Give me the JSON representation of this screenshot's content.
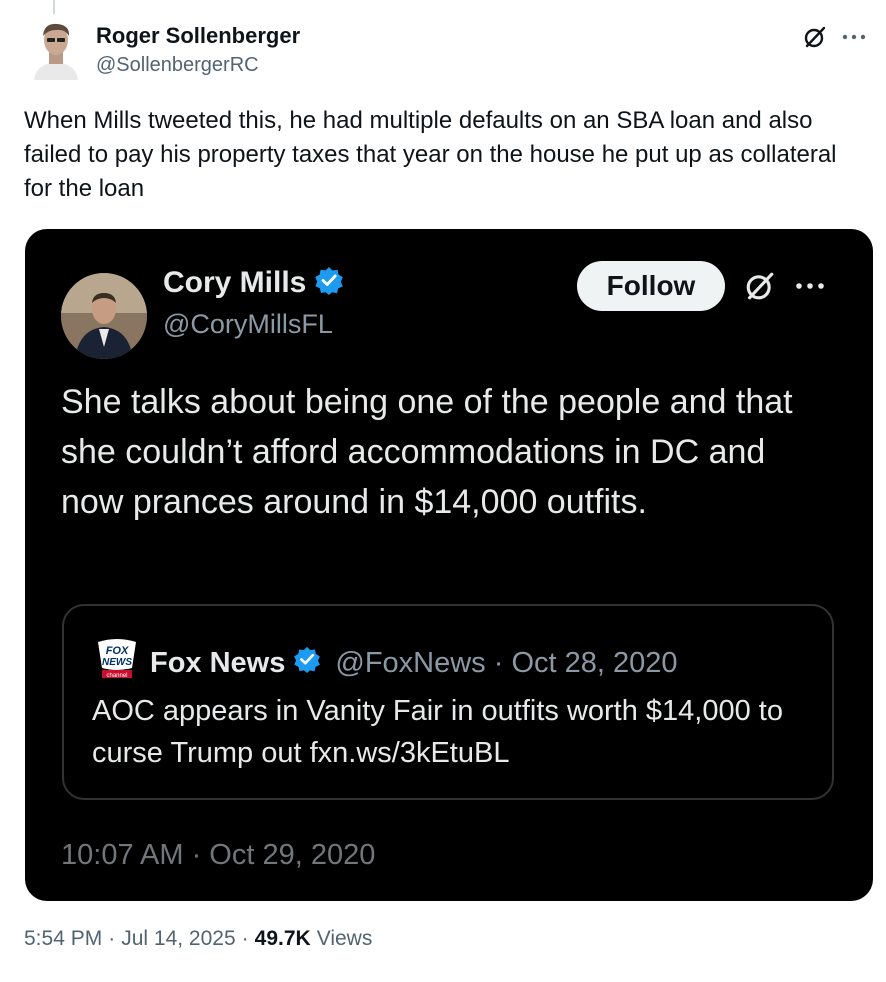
{
  "tweet": {
    "author_name": "Roger Sollenberger",
    "author_handle": "@SollenbergerRC",
    "text": "When Mills tweeted this, he had multiple defaults on an SBA loan and also failed to pay his property taxes that year on the house he put up as collateral for the loan",
    "time": "5:54 PM",
    "date": "Jul 14, 2025",
    "views_count": "49.7K",
    "views_label": "Views",
    "icons": [
      "grok-icon",
      "more-icon"
    ]
  },
  "embedded": {
    "author_name": "Cory Mills",
    "author_handle": "@CoryMillsFL",
    "follow_label": "Follow",
    "text": "She talks about being one of the people and that she couldn’t afford accommodations in DC and now prances around in $14,000 outfits.",
    "timestamp": "10:07 AM · Oct 29, 2020",
    "verified_color": "#1d9bf0",
    "quote": {
      "logo_text": "FOX NEWS",
      "logo_subtext": "channel",
      "author_name": "Fox News",
      "meta": "@FoxNews · Oct 28, 2020",
      "text": "AOC appears in Vanity Fair in outfits worth $14,000 to curse Trump out fxn.ws/3kEtuBL"
    }
  }
}
